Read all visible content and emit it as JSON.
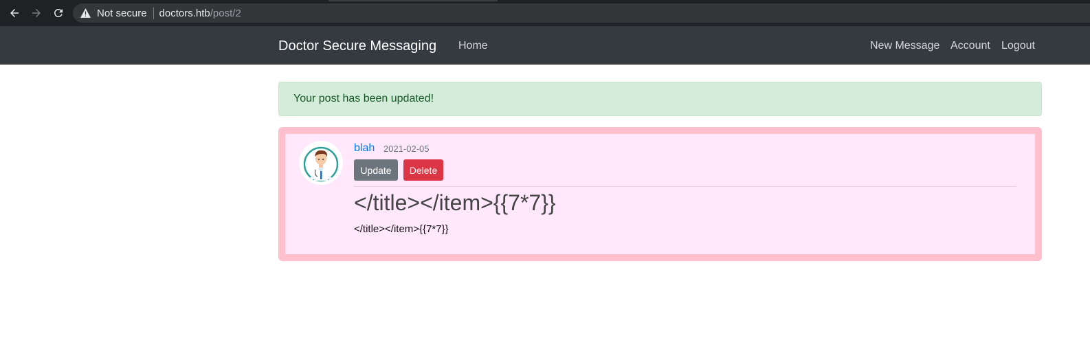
{
  "browser": {
    "security_label": "Not secure",
    "url_host": "doctors.htb",
    "url_path": "/post/2",
    "back_icon": "arrow-left-icon",
    "forward_icon": "arrow-right-icon",
    "reload_icon": "reload-icon",
    "warning_icon": "warning-triangle-icon"
  },
  "navbar": {
    "brand": "Doctor Secure Messaging",
    "left_links": [
      "Home"
    ],
    "right_links": [
      "New Message",
      "Account",
      "Logout"
    ]
  },
  "alert": {
    "message": "Your post has been updated!",
    "color": "#d4edda"
  },
  "post": {
    "author": "blah",
    "date": "2021-02-05",
    "update_label": "Update",
    "delete_label": "Delete",
    "title": "</title></item>{{7*7}}",
    "content": "</title></item>{{7*7}}",
    "avatar_icon": "doctor-avatar-icon",
    "border_color": "#ffbfcc",
    "background_color": "#ffe8fc"
  }
}
